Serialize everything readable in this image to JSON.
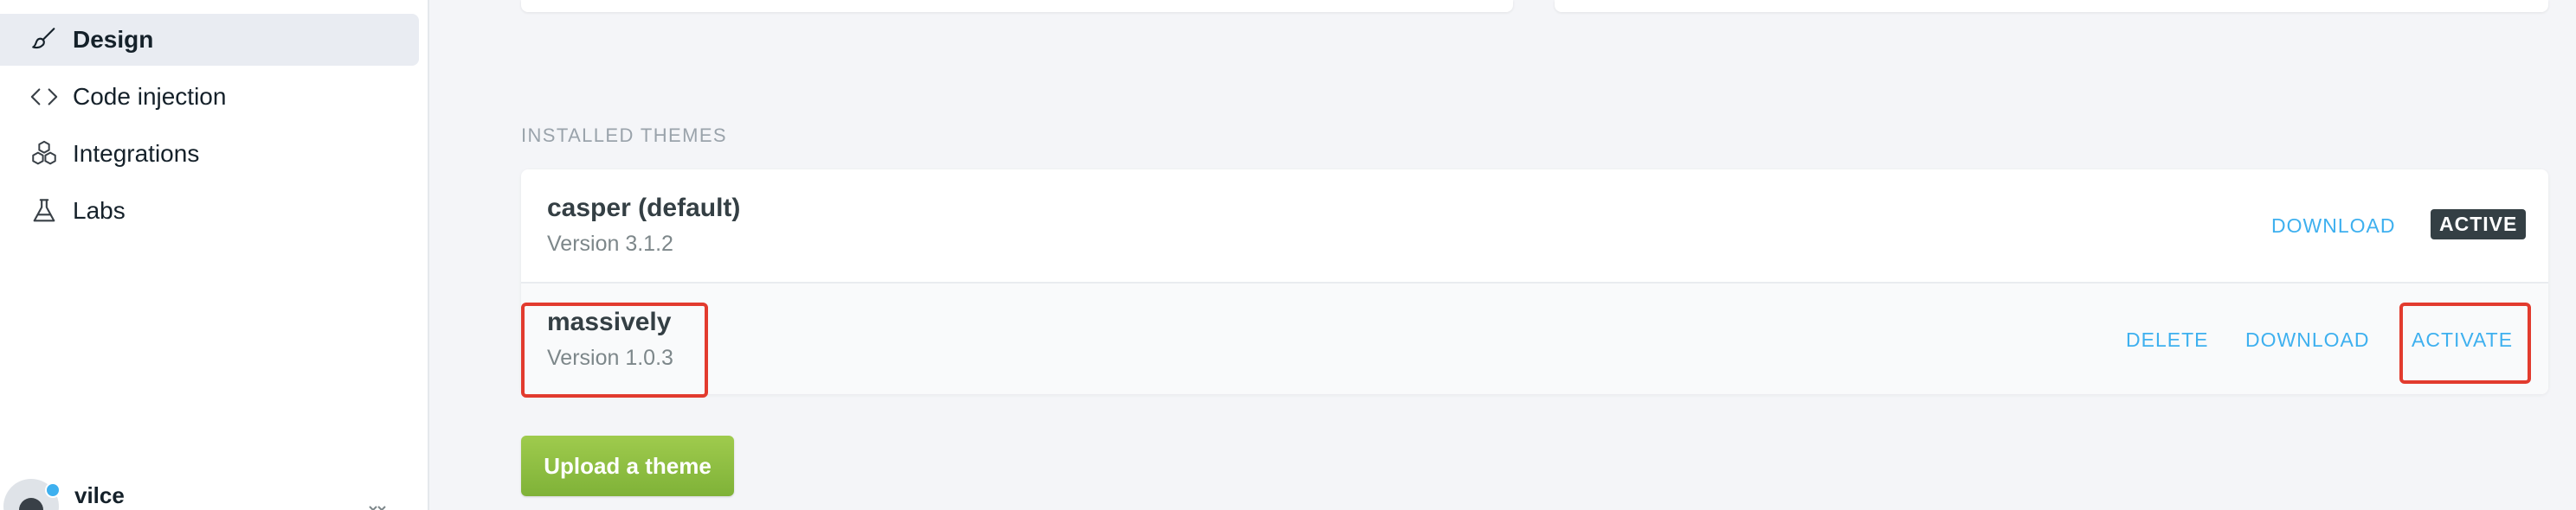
{
  "sidebar": {
    "items": [
      {
        "label": "Design",
        "icon": "paintbrush-icon",
        "active": true
      },
      {
        "label": "Code injection",
        "icon": "code-icon",
        "active": false
      },
      {
        "label": "Integrations",
        "icon": "blocks-icon",
        "active": false
      },
      {
        "label": "Labs",
        "icon": "flask-icon",
        "active": false
      }
    ],
    "user": {
      "name": "vilce"
    }
  },
  "main": {
    "section_label": "INSTALLED THEMES",
    "themes": [
      {
        "name": "casper (default)",
        "version": "Version 3.1.2",
        "actions": [
          "DOWNLOAD"
        ],
        "status": "ACTIVE"
      },
      {
        "name": "massively",
        "version": "Version 1.0.3",
        "actions": [
          "DELETE",
          "DOWNLOAD",
          "ACTIVATE"
        ]
      }
    ],
    "upload_label": "Upload a theme"
  },
  "colors": {
    "accent": "#3eb0ef",
    "highlight": "#e23b2e",
    "upload": "#8bbd3e",
    "badge": "#343f44"
  }
}
